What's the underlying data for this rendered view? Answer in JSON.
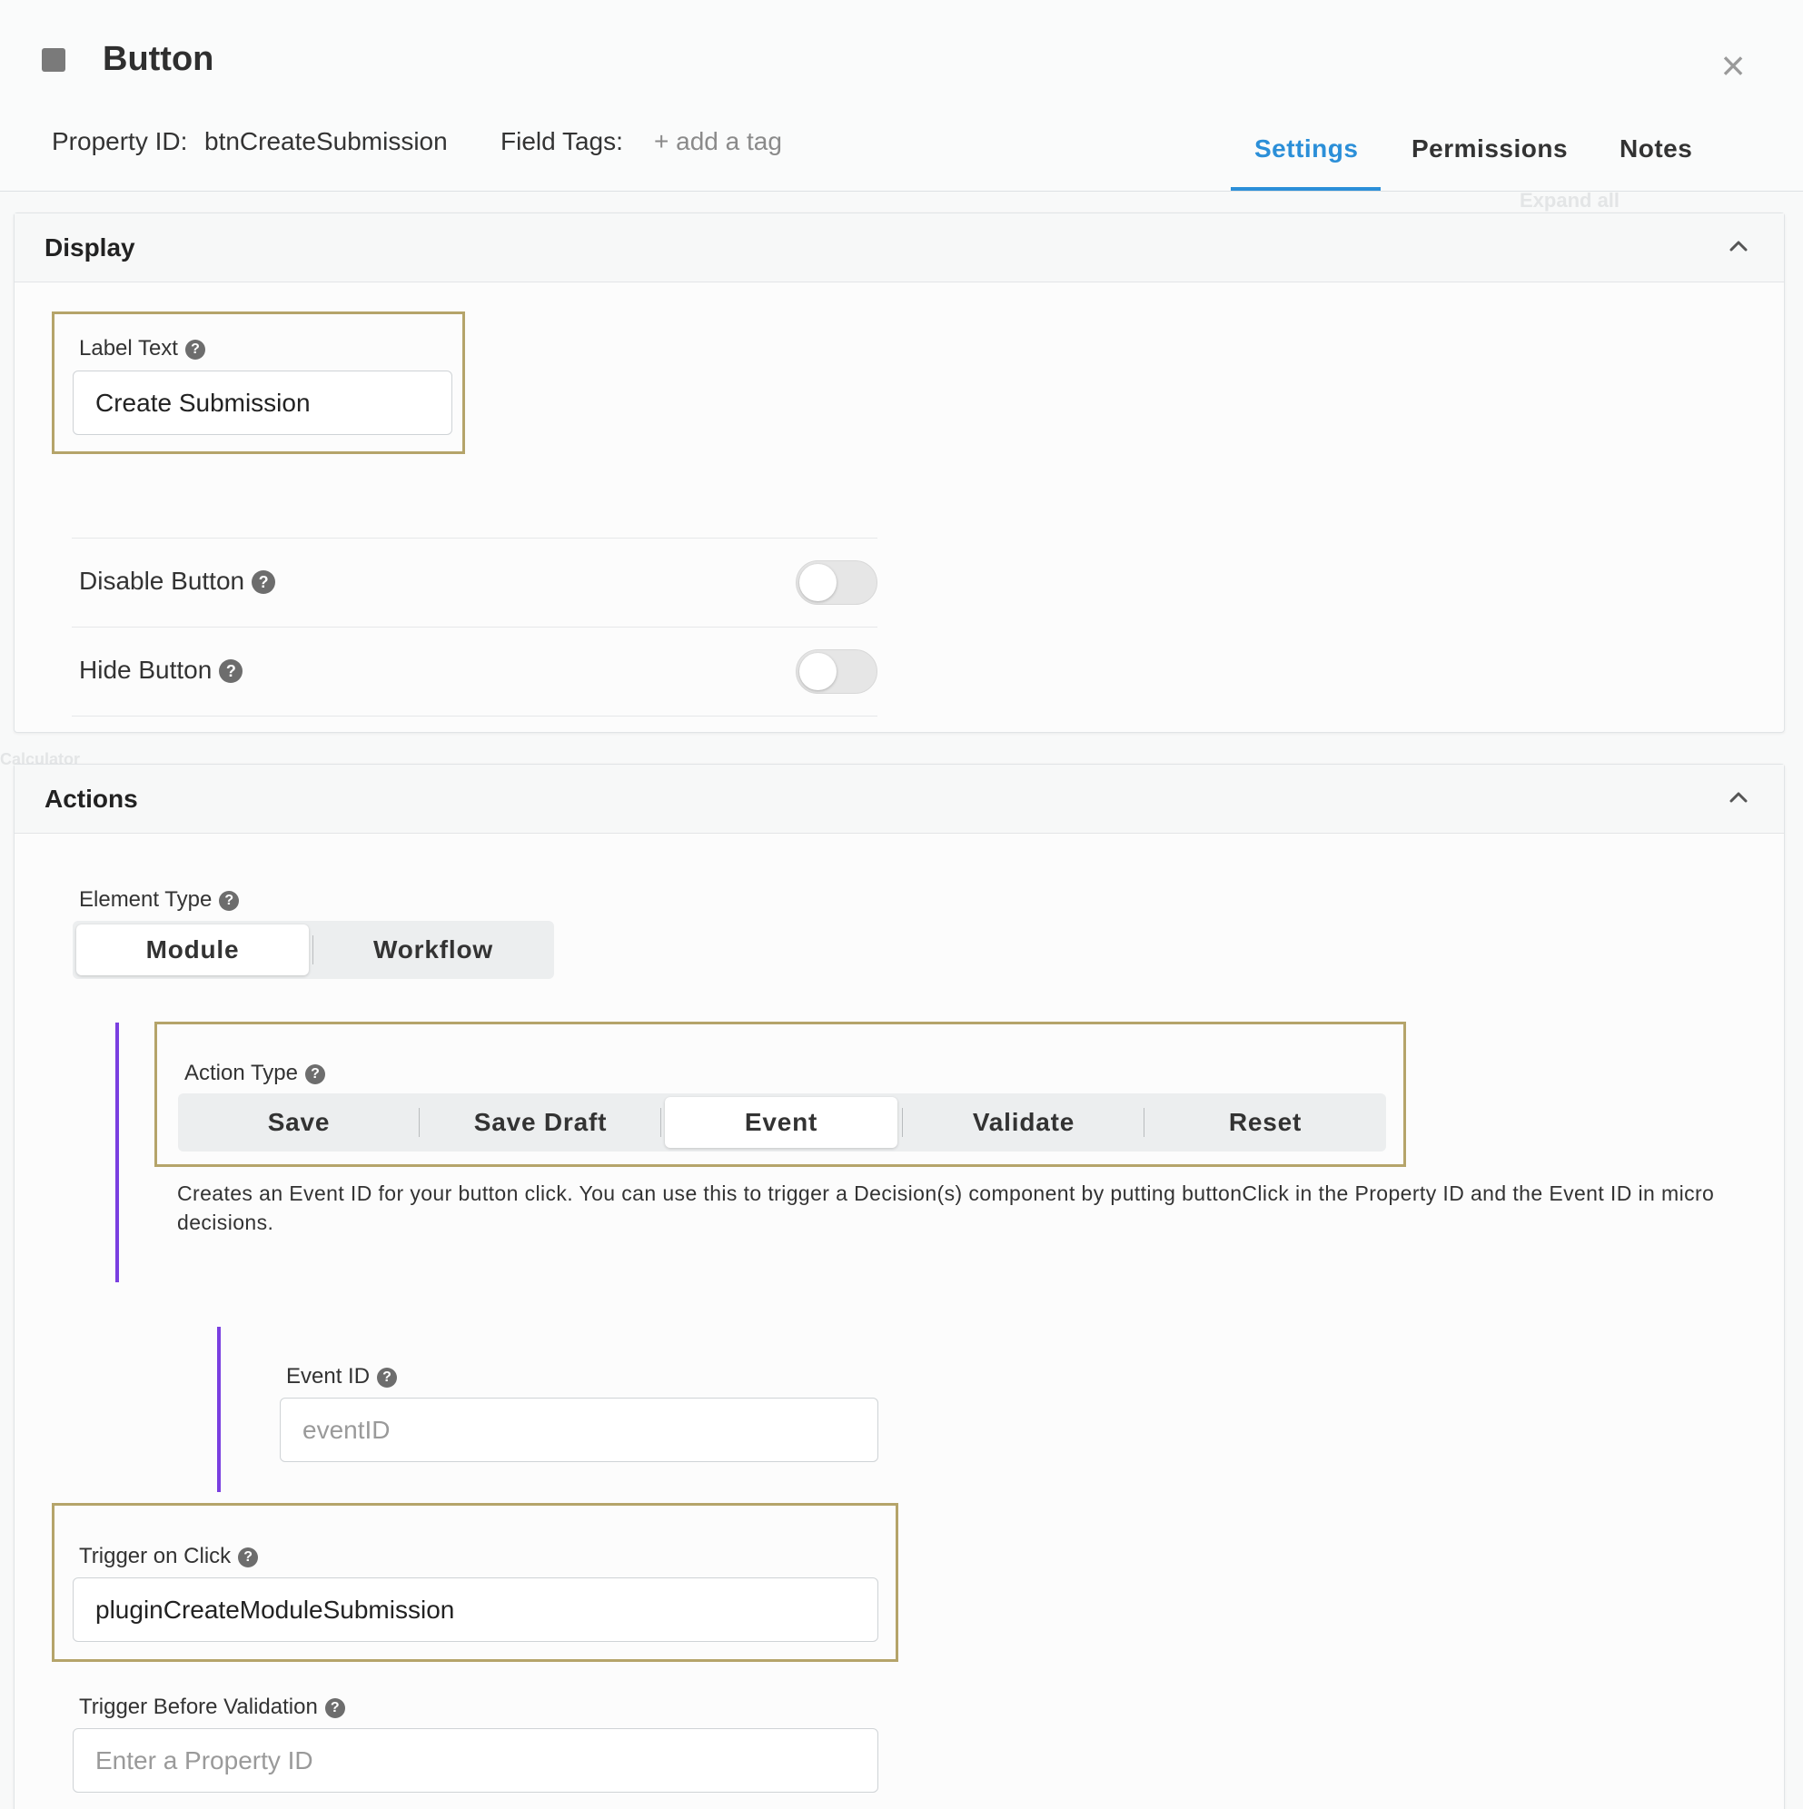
{
  "header": {
    "title": "Button",
    "property_id_label": "Property ID:",
    "property_id_value": "btnCreateSubmission",
    "field_tags_label": "Field Tags:",
    "add_tag_label": "+ add a tag",
    "close_icon": "close-icon",
    "tabs": [
      {
        "label": "Settings",
        "active": true
      },
      {
        "label": "Permissions",
        "active": false
      },
      {
        "label": "Notes",
        "active": false
      }
    ]
  },
  "background": {
    "expand_all": "Expand all",
    "calculator": "Calculator"
  },
  "display": {
    "title": "Display",
    "label_text": {
      "label": "Label Text",
      "value": "Create Submission"
    },
    "disable_button": {
      "label": "Disable Button",
      "on": false
    },
    "hide_button": {
      "label": "Hide Button",
      "on": false
    }
  },
  "actions": {
    "title": "Actions",
    "element_type": {
      "label": "Element Type",
      "options": [
        "Module",
        "Workflow"
      ],
      "selected": "Module"
    },
    "action_type": {
      "label": "Action Type",
      "options": [
        "Save",
        "Save Draft",
        "Event",
        "Validate",
        "Reset"
      ],
      "selected": "Event"
    },
    "description": "Creates an Event ID for your button click. You can use this to trigger a Decision(s) component by putting buttonClick in the Property ID and the Event ID in micro decisions.",
    "event_id": {
      "label": "Event ID",
      "value": "",
      "placeholder": "eventID"
    },
    "trigger_on_click": {
      "label": "Trigger on Click",
      "value": "pluginCreateModuleSubmission"
    },
    "trigger_before_validation": {
      "label": "Trigger Before Validation",
      "value": "",
      "placeholder": "Enter a Property ID"
    }
  },
  "colors": {
    "accent": "#2b8fd8",
    "highlight_border": "#b5a46a",
    "nested_indicator": "#7a3fe0"
  },
  "icons": {
    "help": "question-circle-icon",
    "collapse": "chevron-up-icon",
    "title": "square-icon"
  }
}
